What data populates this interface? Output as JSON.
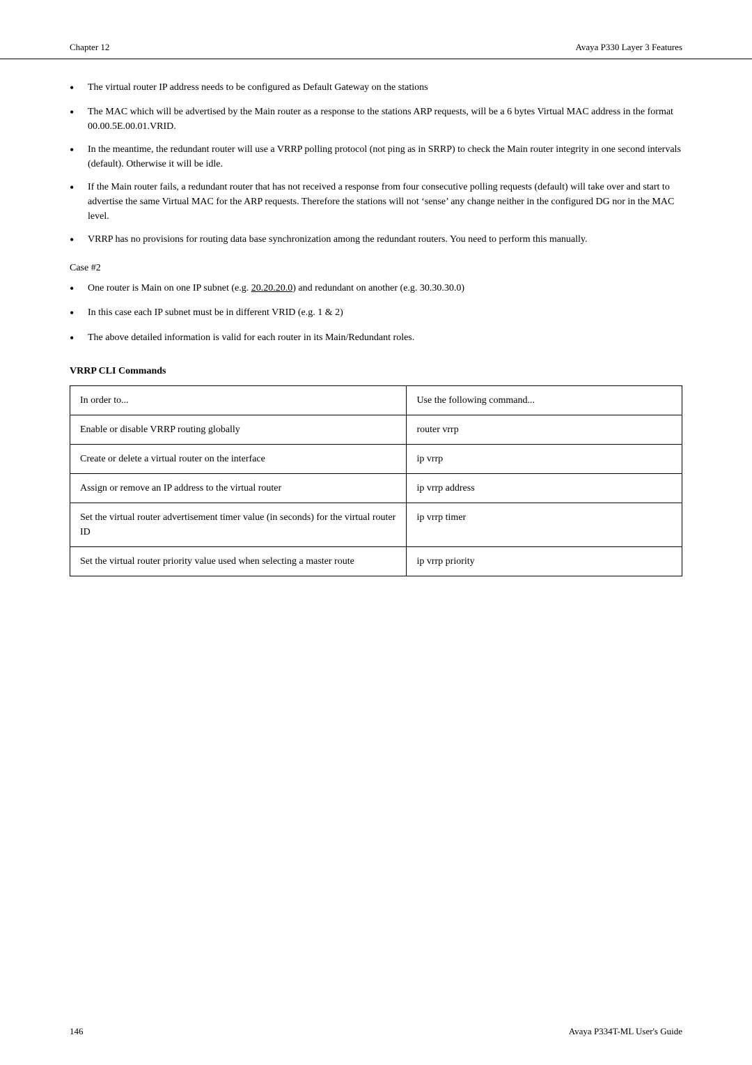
{
  "header": {
    "chapter": "Chapter 12",
    "title": "Avaya P330 Layer 3 Features"
  },
  "footer": {
    "page_number": "146",
    "guide_title": "Avaya P334T-ML User's Guide"
  },
  "bullets_main": [
    "The virtual router IP address needs to be configured as Default Gateway on the stations",
    "The MAC which will be advertised by the Main router as a response to the stations ARP requests, will be a 6 bytes Virtual MAC address in the format 00.00.5E.00.01.VRID.",
    "In the meantime, the redundant router will use a VRRP polling protocol (not ping as in SRRP) to check the Main router integrity in one second intervals (default). Otherwise it will be idle.",
    "If the Main router fails, a redundant router that has not received a response from four consecutive polling requests (default) will take over and start to advertise the same Virtual MAC for the ARP requests. Therefore the stations will not ‘sense’ any change neither in the configured DG nor in the MAC level.",
    "VRRP has no provisions for routing data base synchronization among the redundant routers. You need to perform this manually."
  ],
  "case2": {
    "heading": "Case #2",
    "bullets": [
      "One router is Main on one IP subnet (e.g. 20.20.20.0) and redundant on another (e.g. 30.30.30.0)",
      "In this case each IP subnet must be in different VRID (e.g. 1 & 2)",
      "The above detailed information is valid for each router in its Main/Redundant roles."
    ],
    "subnet_underline": "20.20.20.0"
  },
  "vrrp_section": {
    "heading": "VRRP CLI Commands",
    "table_headers": [
      "In order to...",
      "Use the following command..."
    ],
    "table_rows": [
      {
        "description": "Enable or disable VRRP routing globally",
        "command": "router vrrp"
      },
      {
        "description": "Create or delete a virtual router on the interface",
        "command": "ip vrrp"
      },
      {
        "description": "Assign or remove an IP address to the virtual router",
        "command": "ip vrrp address"
      },
      {
        "description": "Set the virtual router advertisement timer value (in seconds) for the virtual router ID",
        "command": "ip vrrp timer"
      },
      {
        "description": "Set the virtual router priority value used when selecting a master route",
        "command": "ip vrrp priority"
      }
    ]
  }
}
